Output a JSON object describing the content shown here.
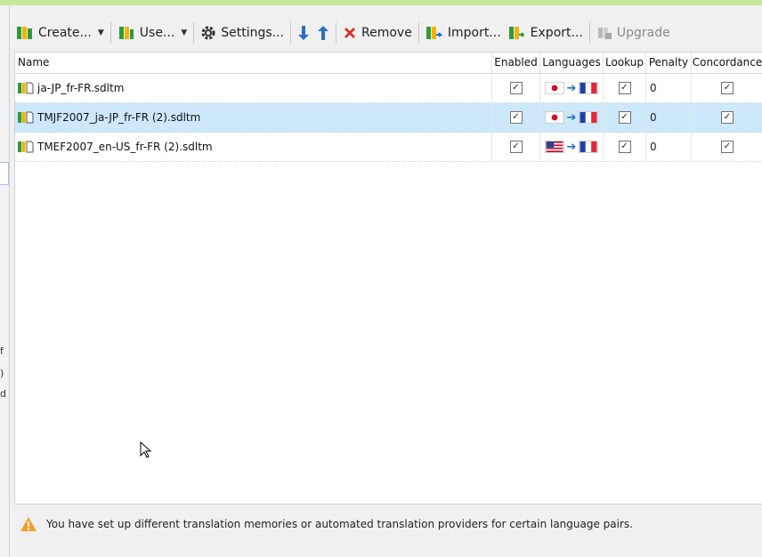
{
  "toolbar": {
    "create_label": "Create...",
    "use_label": "Use...",
    "settings_label": "Settings...",
    "remove_label": "Remove",
    "import_label": "Import...",
    "export_label": "Export...",
    "upgrade_label": "Upgrade"
  },
  "columns": {
    "name": "Name",
    "enabled": "Enabled",
    "languages": "Languages",
    "lookup": "Lookup",
    "penalty": "Penalty",
    "concordance": "Concordance"
  },
  "rows": [
    {
      "name": "ja-JP_fr-FR.sdltm",
      "enabled": true,
      "source_flag": "jp-flag-icon",
      "target_flag": "fr-flag-icon",
      "lookup": true,
      "penalty": "0",
      "concordance": true,
      "selected": false
    },
    {
      "name": "TMJF2007_ja-JP_fr-FR (2).sdltm",
      "enabled": true,
      "source_flag": "jp-flag-icon",
      "target_flag": "fr-flag-icon",
      "lookup": true,
      "penalty": "0",
      "concordance": true,
      "selected": true
    },
    {
      "name": "TMEF2007_en-US_fr-FR (2).sdltm",
      "enabled": true,
      "source_flag": "us-flag-icon",
      "target_flag": "fr-flag-icon",
      "lookup": true,
      "penalty": "0",
      "concordance": true,
      "selected": false
    }
  ],
  "status": {
    "message": "You have set up different translation memories or automated translation providers for certain language pairs.",
    "icon": "warning-icon"
  },
  "left_fragments": [
    "f",
    ")",
    "d"
  ],
  "colors": {
    "selection": "#cde8fb",
    "accent_green": "#c7e89a",
    "warning": "#f0a030",
    "remove_red": "#d9342b",
    "arrow_blue": "#1f6fc7"
  }
}
